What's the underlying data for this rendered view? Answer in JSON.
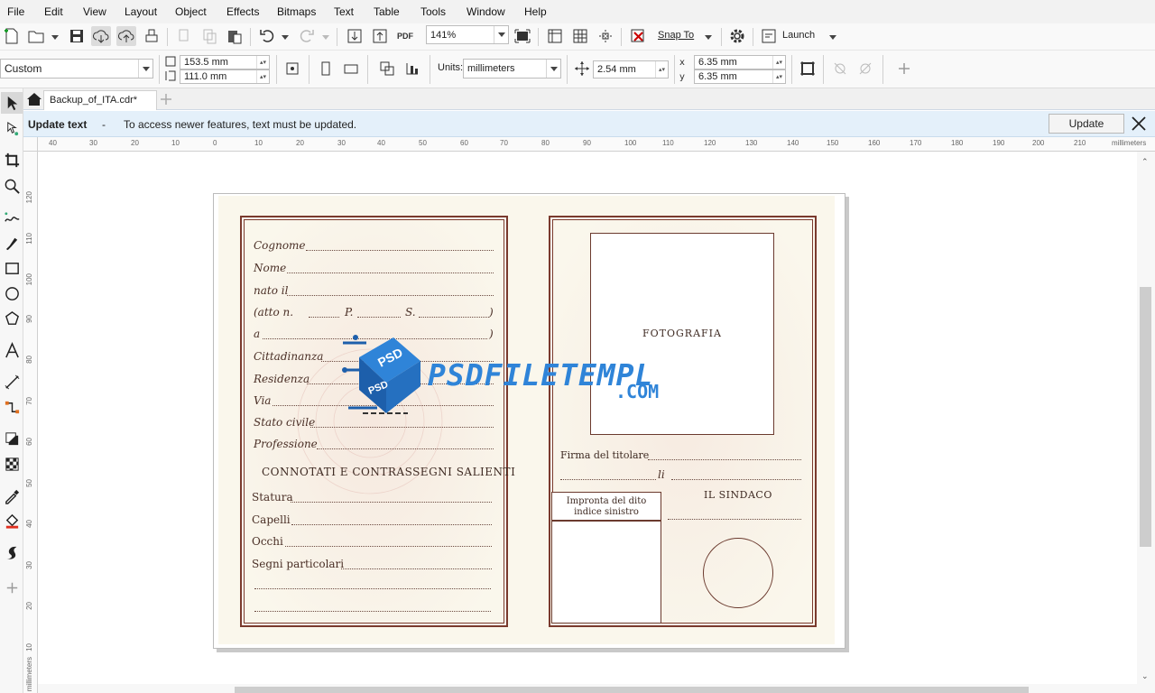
{
  "menu": [
    "File",
    "Edit",
    "View",
    "Layout",
    "Object",
    "Effects",
    "Bitmaps",
    "Text",
    "Table",
    "Tools",
    "Window",
    "Help"
  ],
  "toolbar": {
    "zoom": "141%",
    "snap_to": "Snap To",
    "launch": "Launch",
    "pdf_label": "PDF"
  },
  "property_bar": {
    "page_preset": "Custom",
    "width": "153.5 mm",
    "height": "111.0 mm",
    "units_label": "Units:",
    "units": "millimeters",
    "nudge": "2.54 mm",
    "dup_x": "6.35 mm",
    "dup_y": "6.35 mm"
  },
  "document_tab": "Backup_of_ITA.cdr*",
  "notice": {
    "title": "Update text",
    "dash": "-",
    "message": "To access newer features, text must be updated.",
    "button": "Update"
  },
  "ruler": {
    "h_ticks": [
      "40",
      "30",
      "20",
      "10",
      "0",
      "10",
      "20",
      "30",
      "40",
      "50",
      "60",
      "70",
      "80",
      "90",
      "100",
      "110",
      "120",
      "130",
      "140",
      "150",
      "160",
      "170",
      "180",
      "190",
      "200",
      "210"
    ],
    "h_unit": "millimeters",
    "v_ticks": [
      "120",
      "110",
      "100",
      "90",
      "80",
      "70",
      "60",
      "50",
      "40",
      "30",
      "20",
      "10"
    ],
    "v_unit": "millimeters"
  },
  "id_card": {
    "left_fields": [
      "Cognome",
      "Nome",
      "nato il",
      "(atto n.",
      "a",
      "Cittadinanza",
      "Residenza",
      "Via",
      "Stato civile",
      "Professione"
    ],
    "atto_p": "P.",
    "atto_s": "S.",
    "close_paren": ")",
    "section_title": "CONNOTATI E CONTRASSEGNI SALIENTI",
    "marks_fields": [
      "Statura",
      "Capelli",
      "Occhi",
      "Segni particolari"
    ],
    "photo_label": "FOTOGRAFIA",
    "signature_label": "Firma del titolare",
    "li_label": "li",
    "fingerprint_label_1": "Impronta del dito",
    "fingerprint_label_2": "indice sinistro",
    "mayor_label": "IL SINDACO"
  },
  "watermark": {
    "badge_top": "PSD",
    "badge_bottom": "PSD",
    "brand": "PSDFILETEMPL",
    "tld": ".COM"
  },
  "colors": {
    "border": "#7a3a2e",
    "paper": "#faf7ec",
    "accent_blue": "#1e73c8",
    "notice_bg": "#e4f0fa"
  }
}
